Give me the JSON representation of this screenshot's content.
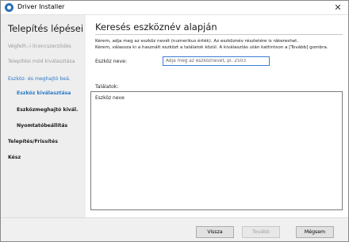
{
  "window": {
    "title": "Driver Installer",
    "close_glyph": "✕"
  },
  "sidebar": {
    "title": "Telepítés lépései",
    "steps": [
      {
        "label": "Végfelh.-i licencszerződés",
        "state": "done"
      },
      {
        "label": "Telepítési mód kiválasztása",
        "state": "done"
      },
      {
        "label": "Eszköz- és meghajtó beá.",
        "state": "active"
      },
      {
        "label": "Eszköz kiválasztása",
        "state": "current-sub"
      },
      {
        "label": "Eszközmeghajtó kivál.",
        "state": "pending-sub"
      },
      {
        "label": "Nyomtatóbeállítás",
        "state": "pending-sub"
      },
      {
        "label": "Telepítés/Frissítés",
        "state": "pending"
      },
      {
        "label": "Kész",
        "state": "pending"
      }
    ]
  },
  "main": {
    "heading": "Keresés eszköznév alapján",
    "description_lines": [
      "Kérem, adja meg az eszköz nevét (numerikus érték). Az eszköznév részletére is rákereshet.",
      "Kérem, válassza ki a használt eszközt a találatok közül. A kiválasztás után kattintson a [Tovább] gombra."
    ],
    "device_name_label": "Eszköz neve:",
    "device_name_placeholder": "Adja meg az eszköznevet, pl. 2503",
    "device_name_value": "",
    "results_label": "Találatok:",
    "results_column_header": "Eszköz neve"
  },
  "footer": {
    "back_label": "Vissza",
    "next_label": "Tovább",
    "cancel_label": "Mégsem"
  },
  "colors": {
    "accent": "#2a78c8",
    "sidebar_bg": "#eeeeee",
    "input_border": "#3b7ed6"
  },
  "icons": {
    "app": "driver-installer-icon",
    "close": "close-icon"
  }
}
